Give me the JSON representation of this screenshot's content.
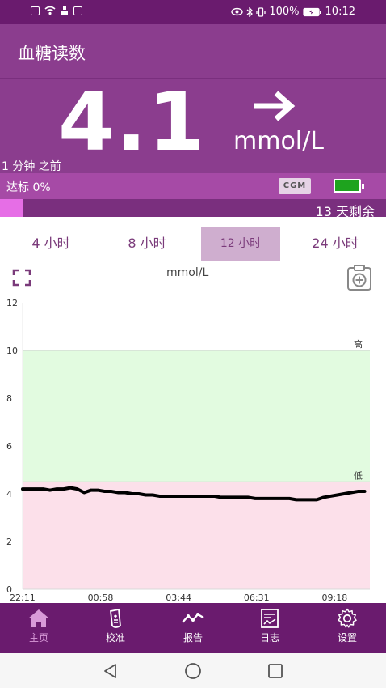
{
  "status": {
    "battery_pct": "100%",
    "time": "10:12"
  },
  "appbar": {
    "title": "血糖读数"
  },
  "reading": {
    "value": "4.1",
    "unit": "mmol/L",
    "trend": "steady-arrow-icon",
    "age": "1 分钟 之前"
  },
  "status_row": {
    "in_range": "达标 0%",
    "cgm_label": "CGM",
    "battery_color": "#1ea31e"
  },
  "sensor": {
    "progress": 0.06,
    "days_left": "13 天剩余"
  },
  "tabs": [
    {
      "label": "4 小时",
      "active": false
    },
    {
      "label": "8 小时",
      "active": false
    },
    {
      "label": "12 小时",
      "active": true
    },
    {
      "label": "24 小时",
      "active": false
    }
  ],
  "chart_unit": "mmol/L",
  "chart_data": {
    "type": "line",
    "ylim": [
      0,
      12
    ],
    "yticks": [
      "0",
      "2",
      "4",
      "6",
      "8",
      "10",
      "12"
    ],
    "x_tick_labels": [
      "22:11",
      "00:58",
      "03:44",
      "06:31",
      "09:18"
    ],
    "target_high": 10,
    "target_low": 4.5,
    "high_label": "高",
    "low_label": "低",
    "colors": {
      "target_band": "#e2fbe0",
      "low_band": "#fce0ea",
      "line": "#000000"
    },
    "series": [
      {
        "x": [
          0,
          0.02,
          0.04,
          0.06,
          0.08,
          0.1,
          0.12,
          0.14,
          0.16,
          0.18,
          0.2,
          0.22,
          0.24,
          0.26,
          0.28,
          0.3,
          0.32,
          0.34,
          0.36,
          0.38,
          0.4,
          0.42,
          0.44,
          0.46,
          0.48,
          0.5,
          0.52,
          0.54,
          0.56,
          0.58,
          0.6,
          0.62,
          0.64,
          0.66,
          0.68,
          0.7,
          0.72,
          0.74,
          0.76,
          0.78,
          0.8,
          0.82,
          0.84,
          0.86,
          0.88,
          0.9,
          0.92,
          0.94,
          0.96,
          0.98,
          1.0
        ],
        "values": [
          4.2,
          4.2,
          4.2,
          4.2,
          4.15,
          4.2,
          4.2,
          4.25,
          4.2,
          4.05,
          4.15,
          4.15,
          4.1,
          4.1,
          4.05,
          4.05,
          4.0,
          4.0,
          3.95,
          3.95,
          3.9,
          3.9,
          3.9,
          3.9,
          3.9,
          3.9,
          3.9,
          3.9,
          3.9,
          3.85,
          3.85,
          3.85,
          3.85,
          3.85,
          3.8,
          3.8,
          3.8,
          3.8,
          3.8,
          3.8,
          3.75,
          3.75,
          3.75,
          3.75,
          3.85,
          3.9,
          3.95,
          4.0,
          4.05,
          4.1,
          4.1
        ]
      }
    ]
  },
  "nav": [
    {
      "label": "主页",
      "icon": "home-icon",
      "active": true
    },
    {
      "label": "校准",
      "icon": "calibrate-icon",
      "active": false
    },
    {
      "label": "报告",
      "icon": "report-icon",
      "active": false
    },
    {
      "label": "日志",
      "icon": "log-icon",
      "active": false
    },
    {
      "label": "设置",
      "icon": "gear-icon",
      "active": false
    }
  ]
}
